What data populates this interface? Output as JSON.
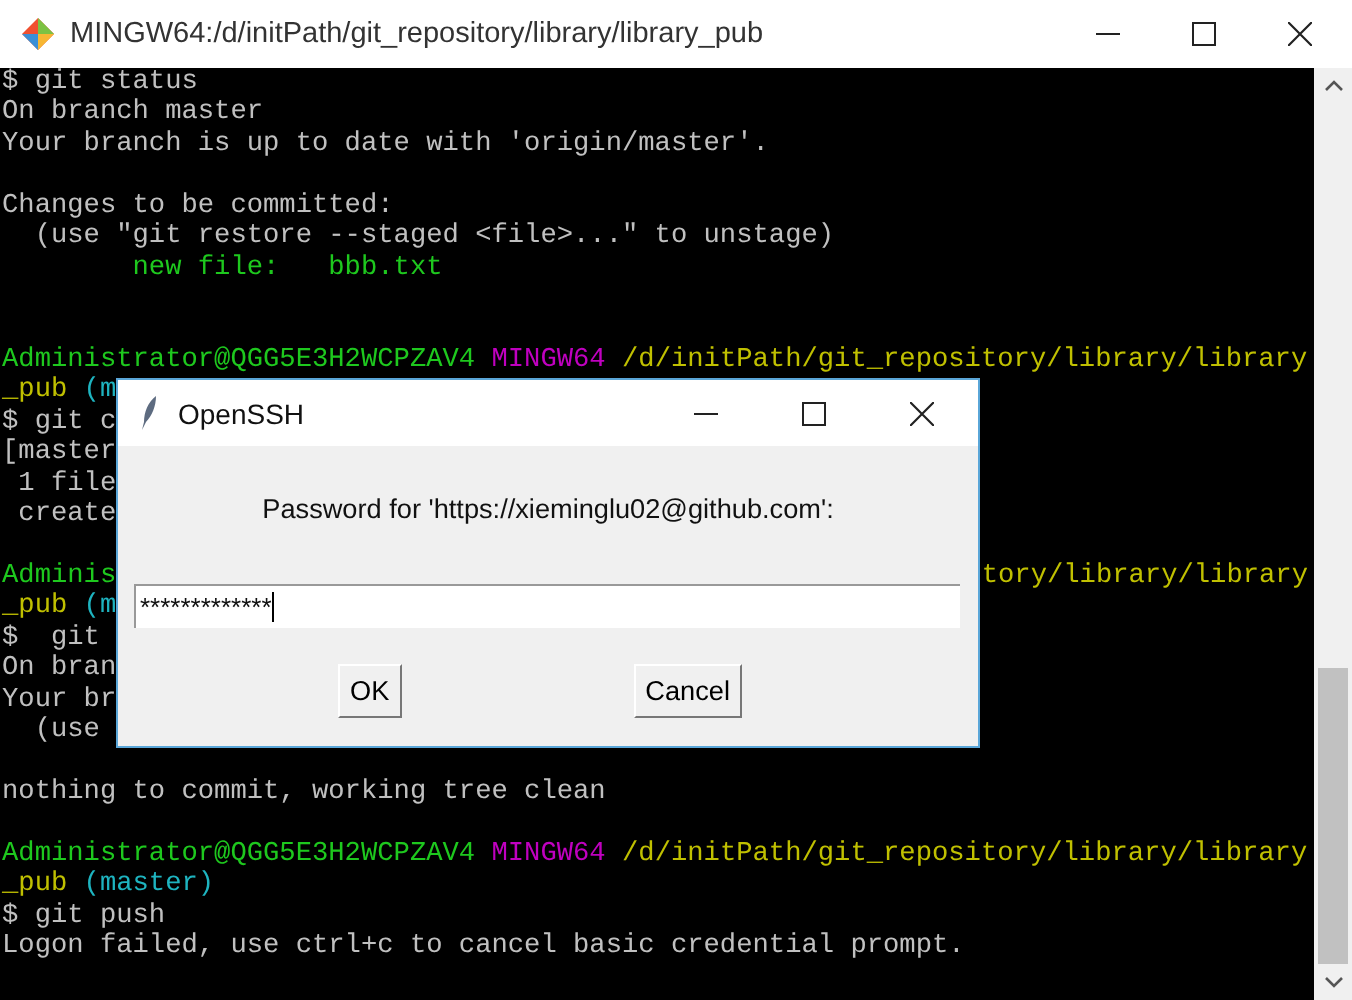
{
  "window": {
    "title": "MINGW64:/d/initPath/git_repository/library/library_pub"
  },
  "terminal": {
    "lines": [
      {
        "kind": "text",
        "segments": [
          {
            "text": "$ git status",
            "color": "#c0c0c0"
          }
        ]
      },
      {
        "kind": "text",
        "segments": [
          {
            "text": "On branch master",
            "color": "#c0c0c0"
          }
        ]
      },
      {
        "kind": "text",
        "segments": [
          {
            "text": "Your branch is up to date with 'origin/master'.",
            "color": "#c0c0c0"
          }
        ]
      },
      {
        "kind": "blank"
      },
      {
        "kind": "text",
        "segments": [
          {
            "text": "Changes to be committed:",
            "color": "#c0c0c0"
          }
        ]
      },
      {
        "kind": "text",
        "segments": [
          {
            "text": "  (use \"git restore --staged <file>...\" to unstage)",
            "color": "#c0c0c0"
          }
        ]
      },
      {
        "kind": "text",
        "segments": [
          {
            "text": "        new file:   bbb.txt",
            "color": "#1ec81e"
          }
        ]
      },
      {
        "kind": "blank"
      },
      {
        "kind": "blank"
      },
      {
        "kind": "text",
        "segments": [
          {
            "text": "Administrator@QGG5E3H2WCPZAV4",
            "color": "#1ec81e"
          },
          {
            "text": " MINGW64",
            "color": "#c000c0"
          },
          {
            "text": " /d/initPath/git_repository/library/library",
            "color": "#c0c000"
          }
        ]
      },
      {
        "kind": "text",
        "segments": [
          {
            "text": "_pub",
            "color": "#c0c000"
          },
          {
            "text": " (m",
            "color": "#1eb4c0"
          }
        ]
      },
      {
        "kind": "text",
        "segments": [
          {
            "text": "$ git c",
            "color": "#c0c0c0"
          }
        ]
      },
      {
        "kind": "text",
        "segments": [
          {
            "text": "[master",
            "color": "#c0c0c0"
          }
        ]
      },
      {
        "kind": "text",
        "segments": [
          {
            "text": " 1 file",
            "color": "#c0c0c0"
          }
        ]
      },
      {
        "kind": "text",
        "segments": [
          {
            "text": " create",
            "color": "#c0c0c0"
          }
        ]
      },
      {
        "kind": "blank"
      },
      {
        "kind": "text",
        "segments": [
          {
            "text": "Adminis",
            "color": "#1ec81e"
          }
        ],
        "after_dialog": [
          {
            "text": "tory/library/library",
            "color": "#c0c000"
          }
        ]
      },
      {
        "kind": "text",
        "segments": [
          {
            "text": "_pub",
            "color": "#c0c000"
          },
          {
            "text": " (m",
            "color": "#1eb4c0"
          }
        ]
      },
      {
        "kind": "text",
        "segments": [
          {
            "text": "$  git",
            "color": "#c0c0c0"
          }
        ]
      },
      {
        "kind": "text",
        "segments": [
          {
            "text": "On bran",
            "color": "#c0c0c0"
          }
        ]
      },
      {
        "kind": "text",
        "segments": [
          {
            "text": "Your br",
            "color": "#c0c0c0"
          }
        ]
      },
      {
        "kind": "text",
        "segments": [
          {
            "text": "  (use",
            "color": "#c0c0c0"
          }
        ]
      },
      {
        "kind": "blank"
      },
      {
        "kind": "text",
        "segments": [
          {
            "text": "nothing to commit, working tree clean",
            "color": "#c0c0c0"
          }
        ]
      },
      {
        "kind": "blank"
      },
      {
        "kind": "text",
        "segments": [
          {
            "text": "Administrator@QGG5E3H2WCPZAV4",
            "color": "#1ec81e"
          },
          {
            "text": " MINGW64",
            "color": "#c000c0"
          },
          {
            "text": " /d/initPath/git_repository/library/library",
            "color": "#c0c000"
          }
        ]
      },
      {
        "kind": "text",
        "segments": [
          {
            "text": "_pub",
            "color": "#c0c000"
          },
          {
            "text": " (master)",
            "color": "#1eb4c0"
          }
        ]
      },
      {
        "kind": "text",
        "segments": [
          {
            "text": "$ git push",
            "color": "#c0c0c0"
          }
        ]
      },
      {
        "kind": "text",
        "segments": [
          {
            "text": "Logon failed, use ctrl+c to cancel basic credential prompt.",
            "color": "#c0c0c0"
          }
        ]
      }
    ]
  },
  "dialog": {
    "title": "OpenSSH",
    "prompt": "Password for 'https://xieminglu02@github.com':",
    "password": {
      "value": "*************"
    },
    "buttons": [
      "OK",
      "Cancel"
    ]
  }
}
